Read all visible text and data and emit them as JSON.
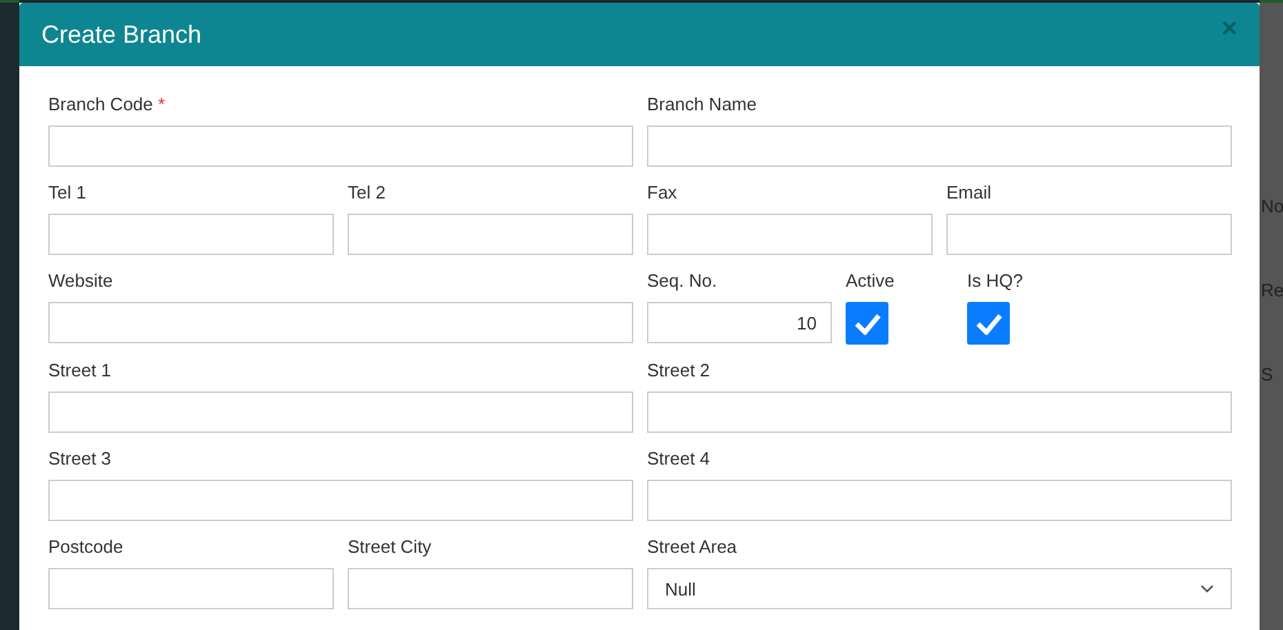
{
  "background": {
    "fragments": [
      "No",
      "Re",
      "S"
    ]
  },
  "dialog": {
    "title": "Create Branch",
    "close": "×"
  },
  "rows": [
    [
      {
        "kind": "text",
        "label": "Branch Code",
        "required_mark": "*"
      },
      {
        "kind": "text",
        "label": "Branch Name"
      }
    ],
    [
      {
        "kind": "text",
        "label": "Tel 1"
      },
      {
        "kind": "text",
        "label": "Tel 2"
      },
      {
        "kind": "text",
        "label": "Fax"
      },
      {
        "kind": "text",
        "label": "Email"
      }
    ],
    [
      {
        "kind": "text",
        "label": "Website"
      },
      {
        "kind": "number",
        "label": "Seq. No.",
        "value": "10"
      },
      {
        "kind": "checkbox",
        "label": "Active",
        "checked": true
      },
      {
        "kind": "checkbox",
        "label": "Is HQ?",
        "checked": true
      }
    ],
    [
      {
        "kind": "text",
        "label": "Street 1"
      },
      {
        "kind": "text",
        "label": "Street 2"
      }
    ],
    [
      {
        "kind": "text",
        "label": "Street 3"
      },
      {
        "kind": "text",
        "label": "Street 4"
      }
    ],
    [
      {
        "kind": "text",
        "label": "Postcode"
      },
      {
        "kind": "text",
        "label": "Street City"
      },
      {
        "kind": "select",
        "label": "Street Area",
        "value": "Null"
      }
    ]
  ]
}
